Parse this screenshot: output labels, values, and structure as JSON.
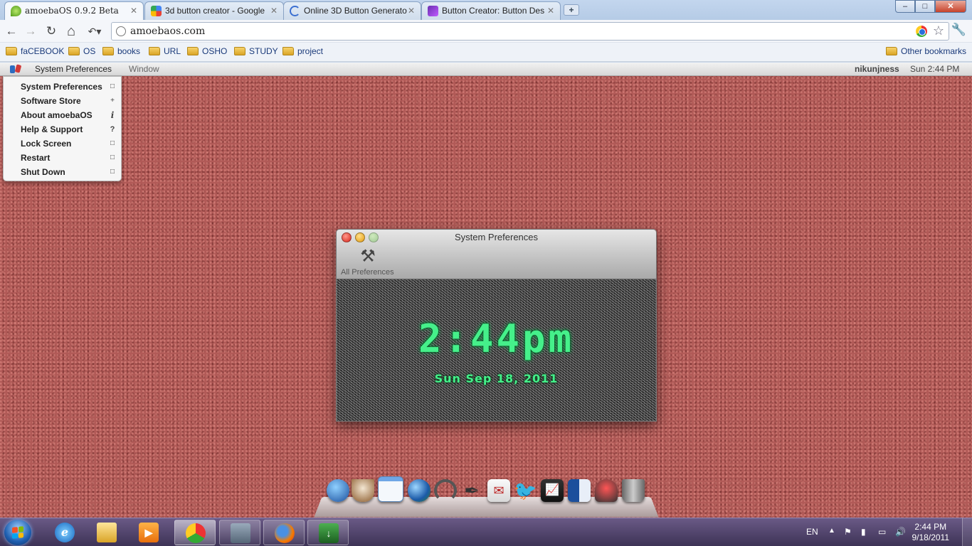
{
  "browser": {
    "tabs": [
      {
        "title": "amoebaOS 0.9.2 Beta",
        "icon": "amoeba-favicon",
        "active": true
      },
      {
        "title": "3d button creator - Google",
        "icon": "google-favicon",
        "active": false
      },
      {
        "title": "Online 3D Button Generato",
        "icon": "loading-favicon",
        "active": false
      },
      {
        "title": "Button Creator: Button Des",
        "icon": "buttoncreator-favicon",
        "active": false
      }
    ],
    "new_tab_label": "+",
    "window_controls": {
      "minimize": "–",
      "maximize": "□",
      "close": "✕"
    },
    "url": "amoebaos.com",
    "bookmarks": [
      "faCEBOOK",
      "OS",
      "books",
      "URL",
      "OSHO",
      "STUDY",
      "project"
    ],
    "other_bookmarks": "Other bookmarks",
    "nav_glyphs": {
      "back": "←",
      "forward": "→",
      "reload": "↻",
      "home": "⌂",
      "history": "↶▾",
      "star": "☆",
      "wrench": "🔧"
    }
  },
  "amoeba": {
    "menubar": {
      "app_name": "System Preferences",
      "window_menu": "Window",
      "username": "nikunjness",
      "time": "Sun 2:44 PM"
    },
    "dropdown": [
      {
        "label": "System Preferences",
        "glyph": "□"
      },
      {
        "label": "Software Store",
        "glyph": "+"
      },
      {
        "label": "About amoebaOS",
        "glyph": "i"
      },
      {
        "label": "Help & Support",
        "glyph": "?"
      },
      {
        "label": "Lock Screen",
        "glyph": "□"
      },
      {
        "label": "Restart",
        "glyph": "□"
      },
      {
        "label": "Shut Down",
        "glyph": "□"
      }
    ],
    "pref_window": {
      "title": "System Preferences",
      "toolbar_item": "All Preferences",
      "clock_time": "2:44pm",
      "clock_date": "Sun Sep 18, 2011"
    },
    "dock": [
      "globe-icon",
      "coffee-cup-icon",
      "window-icon",
      "earth-icon",
      "headphones-icon",
      "pen-icon",
      "mail-icon",
      "bird-icon",
      "chart-icon",
      "book-icon",
      "paint-icon",
      "trash-icon"
    ],
    "colors": {
      "clock_green": "#45f08a",
      "desktop": "#b15a57"
    }
  },
  "taskbar": {
    "pinned": [
      "ie-icon",
      "explorer-icon",
      "media-player-icon",
      "chrome-icon",
      "computer-icon",
      "firefox-icon",
      "download-manager-icon"
    ],
    "language": "EN",
    "time": "2:44 PM",
    "date": "9/18/2011"
  }
}
